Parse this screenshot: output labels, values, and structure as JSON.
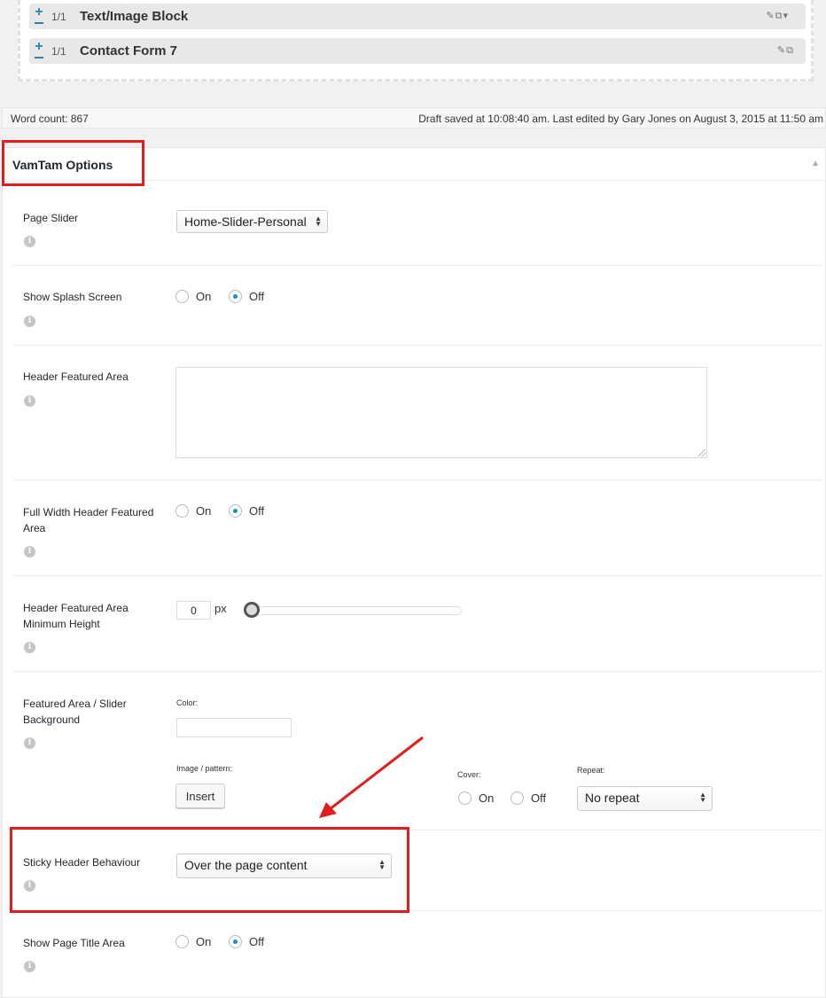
{
  "builder": {
    "blocks": [
      {
        "fraction": "1/1",
        "title": "Text/Image Block",
        "icons": "✎⧉▾"
      },
      {
        "fraction": "1/1",
        "title": "Contact Form 7",
        "icons": "✎⧉"
      }
    ]
  },
  "status": {
    "word_count": "Word count: 867",
    "draft_info": "Draft saved at 10:08:40 am. Last edited by Gary Jones on August 3, 2015 at 11:50 am"
  },
  "panel": {
    "title": "VamTam Options",
    "toggle_icon": "▲"
  },
  "options": {
    "page_slider": {
      "label": "Page Slider",
      "value": "Home-Slider-Personal"
    },
    "splash_screen": {
      "label": "Show Splash Screen",
      "on": "On",
      "off": "Off",
      "selected": "off"
    },
    "header_featured_area": {
      "label": "Header Featured Area",
      "value": ""
    },
    "full_width_header": {
      "label": "Full Width Header Featured Area",
      "on": "On",
      "off": "Off",
      "selected": "off"
    },
    "min_height": {
      "label": "Header Featured Area Minimum Height",
      "value": "0",
      "unit": "px"
    },
    "featured_bg": {
      "label": "Featured Area / Slider Background",
      "color_label": "Color:",
      "image_label": "Image / pattern:",
      "insert_label": "Insert",
      "cover_label": "Cover:",
      "cover_on": "On",
      "cover_off": "Off",
      "repeat_label": "Repeat:",
      "repeat_value": "No repeat"
    },
    "sticky_header": {
      "label": "Sticky Header Behaviour",
      "value": "Over the page content"
    },
    "page_title_area": {
      "label": "Show Page Title Area",
      "on": "On",
      "off": "Off",
      "selected": "off"
    }
  },
  "info_glyph": "i",
  "select_arrows": "▲▼",
  "colors": {
    "highlight": "#e01e1e",
    "accent": "#1e8cbe"
  }
}
